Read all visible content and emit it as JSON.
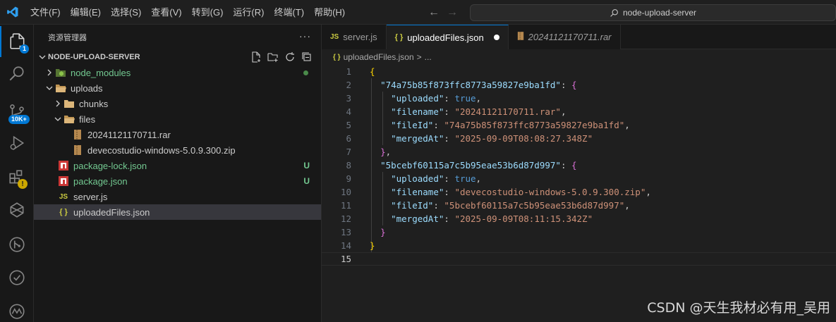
{
  "menu": [
    "文件(F)",
    "编辑(E)",
    "选择(S)",
    "查看(V)",
    "转到(G)",
    "运行(R)",
    "终端(T)",
    "帮助(H)"
  ],
  "nav": {
    "back": "←",
    "forward": "→"
  },
  "command_center": {
    "text": "node-upload-server"
  },
  "activity": {
    "explorer_badge": "1",
    "scm_badge": "10K+",
    "ext_warn": "!"
  },
  "sidebar": {
    "title": "资源管理器",
    "more": "···",
    "project": "NODE-UPLOAD-SERVER",
    "tree": [
      {
        "label": "node_modules",
        "status": ""
      },
      {
        "label": "uploads",
        "status": ""
      },
      {
        "label": "chunks",
        "status": ""
      },
      {
        "label": "files",
        "status": ""
      },
      {
        "label": "20241121170711.rar",
        "status": ""
      },
      {
        "label": "devecostudio-windows-5.0.9.300.zip",
        "status": ""
      },
      {
        "label": "package-lock.json",
        "status": "U"
      },
      {
        "label": "package.json",
        "status": "U"
      },
      {
        "label": "server.js",
        "status": ""
      },
      {
        "label": "uploadedFiles.json",
        "status": ""
      }
    ]
  },
  "tabs": [
    {
      "icon": "JS",
      "label": "server.js"
    },
    {
      "icon": "{ }",
      "label": "uploadedFiles.json"
    },
    {
      "icon": "rar",
      "label": "20241121170711.rar"
    }
  ],
  "breadcrumb": {
    "file": "uploadedFiles.json",
    "sep": ">",
    "rest": "..."
  },
  "code_lines": [
    "1",
    "2",
    "3",
    "4",
    "5",
    "6",
    "7",
    "8",
    "9",
    "10",
    "11",
    "12",
    "13",
    "14",
    "15"
  ],
  "code": {
    "open": "{",
    "id1": "\"74a75b85f873ffc8773a59827e9ba1fd\"",
    "id2": "\"5bcebf60115a7c5b95eae53b6d87d997\"",
    "k_uploaded": "\"uploaded\"",
    "k_filename": "\"filename\"",
    "k_fileId": "\"fileId\"",
    "k_mergedAt": "\"mergedAt\"",
    "true": "true",
    "fn1": "\"20241121170711.rar\"",
    "fid1": "\"74a75b85f873ffc8773a59827e9ba1fd\"",
    "m1": "\"2025-09-09T08:08:27.348Z\"",
    "fn2": "\"devecostudio-windows-5.0.9.300.zip\"",
    "fid2": "\"5bcebf60115a7c5b95eae53b6d87d997\"",
    "m2": "\"2025-09-09T08:11:15.342Z\"",
    "close": "}"
  },
  "watermark": "CSDN @天生我材必有用_吴用"
}
